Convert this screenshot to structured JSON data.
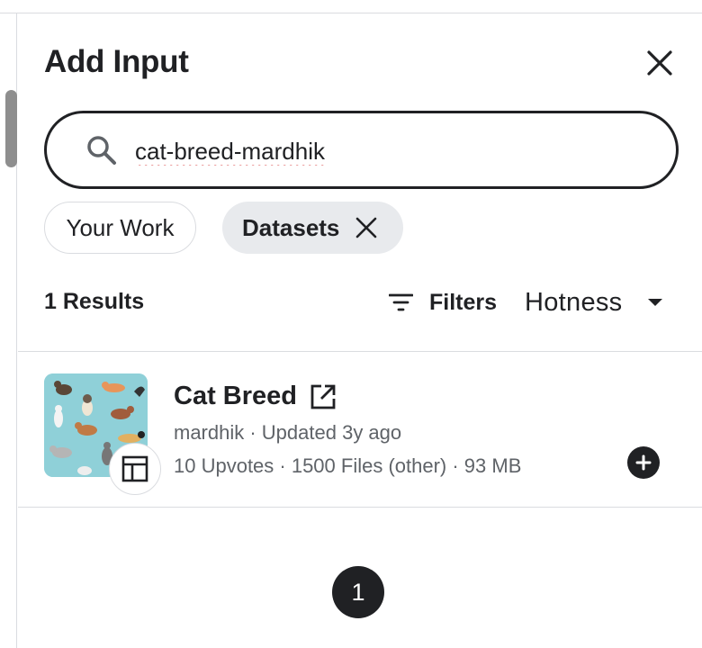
{
  "panel": {
    "title": "Add Input"
  },
  "search": {
    "value": "cat-breed-mardhik",
    "placeholder": ""
  },
  "chips": {
    "your_work": "Your Work",
    "datasets": "Datasets"
  },
  "results": {
    "count_label": "1 Results",
    "filters_label": "Filters",
    "sort_label": "Hotness"
  },
  "items": [
    {
      "title": "Cat Breed",
      "owner_updated": "mardhik · Updated 3y ago",
      "stats": "10 Upvotes · 1500 Files (other) · 93 MB",
      "thumbnail_icon": "cats-illustration",
      "type_icon": "table-icon"
    }
  ],
  "pagination": {
    "current_page": "1"
  },
  "colors": {
    "text": "#202124",
    "muted": "#5f6368",
    "chip_active_bg": "#e8eaed",
    "divider": "#dadce0"
  }
}
